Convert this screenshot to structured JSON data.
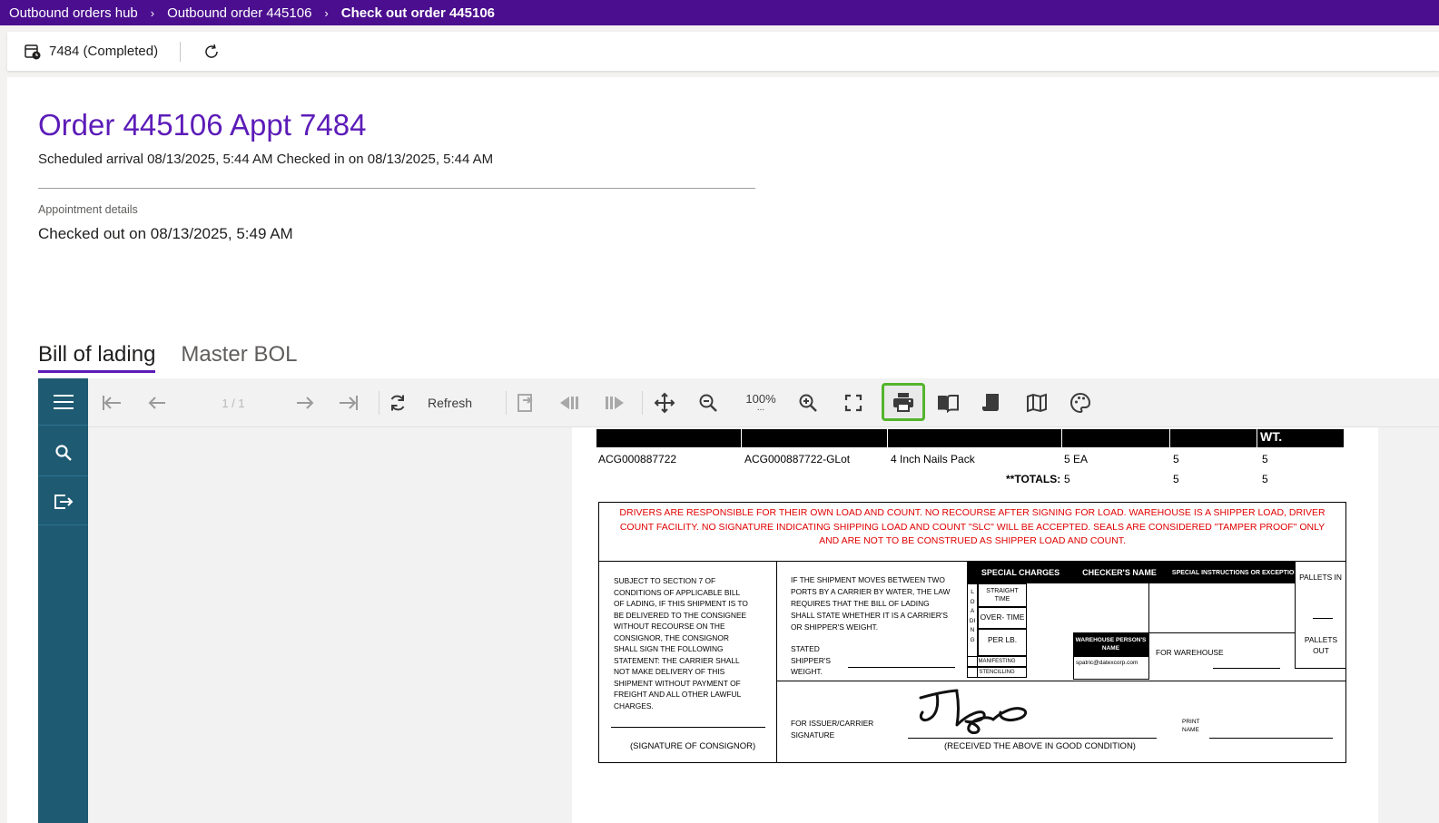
{
  "breadcrumb": {
    "items": [
      "Outbound orders hub",
      "Outbound order 445106",
      "Check out order 445106"
    ],
    "separator": "›"
  },
  "actionbar": {
    "appointment_label": "7484 (Completed)",
    "refresh_icon": "refresh-icon"
  },
  "header": {
    "title": "Order 445106 Appt 7484",
    "subtitle": "Scheduled arrival 08/13/2025, 5:44 AM Checked in on 08/13/2025, 5:44 AM"
  },
  "details": {
    "label": "Appointment details",
    "value": "Checked out on 08/13/2025, 5:49 AM"
  },
  "tabs": [
    {
      "label": "Bill of lading",
      "selected": true
    },
    {
      "label": "Master BOL",
      "selected": false
    }
  ],
  "viewer": {
    "page_indicator": "1 / 1",
    "refresh_label": "Refresh",
    "zoom": "100%",
    "zoom_more": "...",
    "colors": {
      "sidebar": "#1e5a72",
      "highlight": "#53b52c",
      "accent": "#5c1cb8"
    }
  },
  "document": {
    "wt_header": "WT.",
    "line": {
      "item": "ACG000887722",
      "lot": "ACG000887722-GLot",
      "description": "4 Inch Nails Pack",
      "qty": "5 EA",
      "col5": "5",
      "col6": "5"
    },
    "totals": {
      "label": "**TOTALS:",
      "qty": "5",
      "col5": "5",
      "col6": "5"
    },
    "warning": "DRIVERS ARE RESPONSIBLE FOR THEIR OWN LOAD AND COUNT. NO RECOURSE AFTER SIGNING FOR LOAD. WAREHOUSE IS A SHIPPER LOAD, DRIVER COUNT FACILITY. NO SIGNATURE INDICATING SHIPPING LOAD AND COUNT \"SLC\" WILL BE ACCEPTED. SEALS ARE CONSIDERED \"TAMPER PROOF\" ONLY AND ARE NOT TO BE CONSTRUED AS SHIPPER LOAD AND COUNT.",
    "section7": "SUBJECT TO SECTION 7 OF CONDITIONS OF APPLICABLE BILL OF LADING, IF THIS SHIPMENT IS TO BE DELIVERED TO THE CONSIGNEE WITHOUT RECOURSE ON THE CONSIGNOR, THE CONSIGNOR SHALL SIGN THE FOLLOWING STATEMENT: THE CARRIER SHALL NOT MAKE DELIVERY OF THIS SHIPMENT WITHOUT PAYMENT OF FREIGHT AND ALL OTHER LAWFUL CHARGES.",
    "consignor_sig": "(SIGNATURE OF CONSIGNOR)",
    "water": "IF THE SHIPMENT MOVES BETWEEN TWO PORTS BY A CARRIER BY WATER, THE LAW REQUIRES THAT THE BILL OF LADING SHALL STATE WHETHER IT IS A CARRIER'S OR SHIPPER'S WEIGHT.",
    "stated_weight": "STATED SHIPPER'S WEIGHT.",
    "special_charges": "SPECIAL CHARGES",
    "checkers_name": "CHECKER'S NAME",
    "special_instructions": "SPECIAL INSTRUCTIONS OR EXCEPTIONS",
    "loading_letters": [
      "L",
      "O",
      "A",
      "DI",
      "N",
      "G"
    ],
    "straight_time": "STRAIGHT TIME",
    "over_time": "OVER- TIME",
    "per_lb": "PER LB.",
    "manifesting": "MANIFESTING",
    "stenciling": "STENCILLING",
    "warehouse_person": "WAREHOUSE PERSON'S NAME",
    "warehouse_email": "spatric@datexcorp.com",
    "for_warehouse": "FOR WAREHOUSE",
    "pallets_in": "PALLETS IN",
    "pallets_out": "PALLETS OUT",
    "issuer_sig": "FOR ISSUER/CARRIER SIGNATURE",
    "received": "(RECEIVED THE ABOVE IN GOOD CONDITION)",
    "print_name": "PRINT NAME"
  }
}
